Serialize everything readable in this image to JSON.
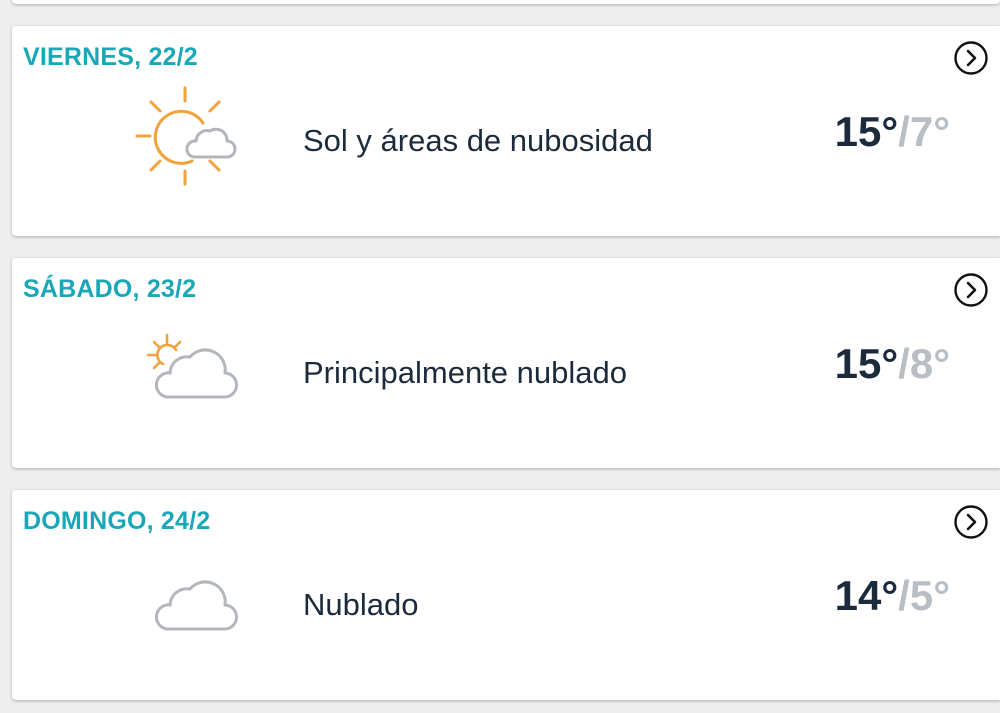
{
  "forecast": {
    "days": [
      {
        "day_label": "VIERNES, 22/2",
        "condition": "Sol y áreas de nubosidad",
        "high": "15°",
        "low": "/7°",
        "icon": "sun-and-cloud-icon"
      },
      {
        "day_label": "SÁBADO, 23/2",
        "condition": "Principalmente nublado",
        "high": "15°",
        "low": "/8°",
        "icon": "mostly-cloudy-icon"
      },
      {
        "day_label": "DOMINGO, 24/2",
        "condition": "Nublado",
        "high": "14°",
        "low": "/5°",
        "icon": "cloud-icon"
      }
    ]
  },
  "colors": {
    "day_label": "#1aa7b7",
    "text_primary": "#1c2b3c",
    "text_low_temp": "#b9bec4",
    "sun": "#f2a23c",
    "cloud": "#b3b6ba"
  }
}
